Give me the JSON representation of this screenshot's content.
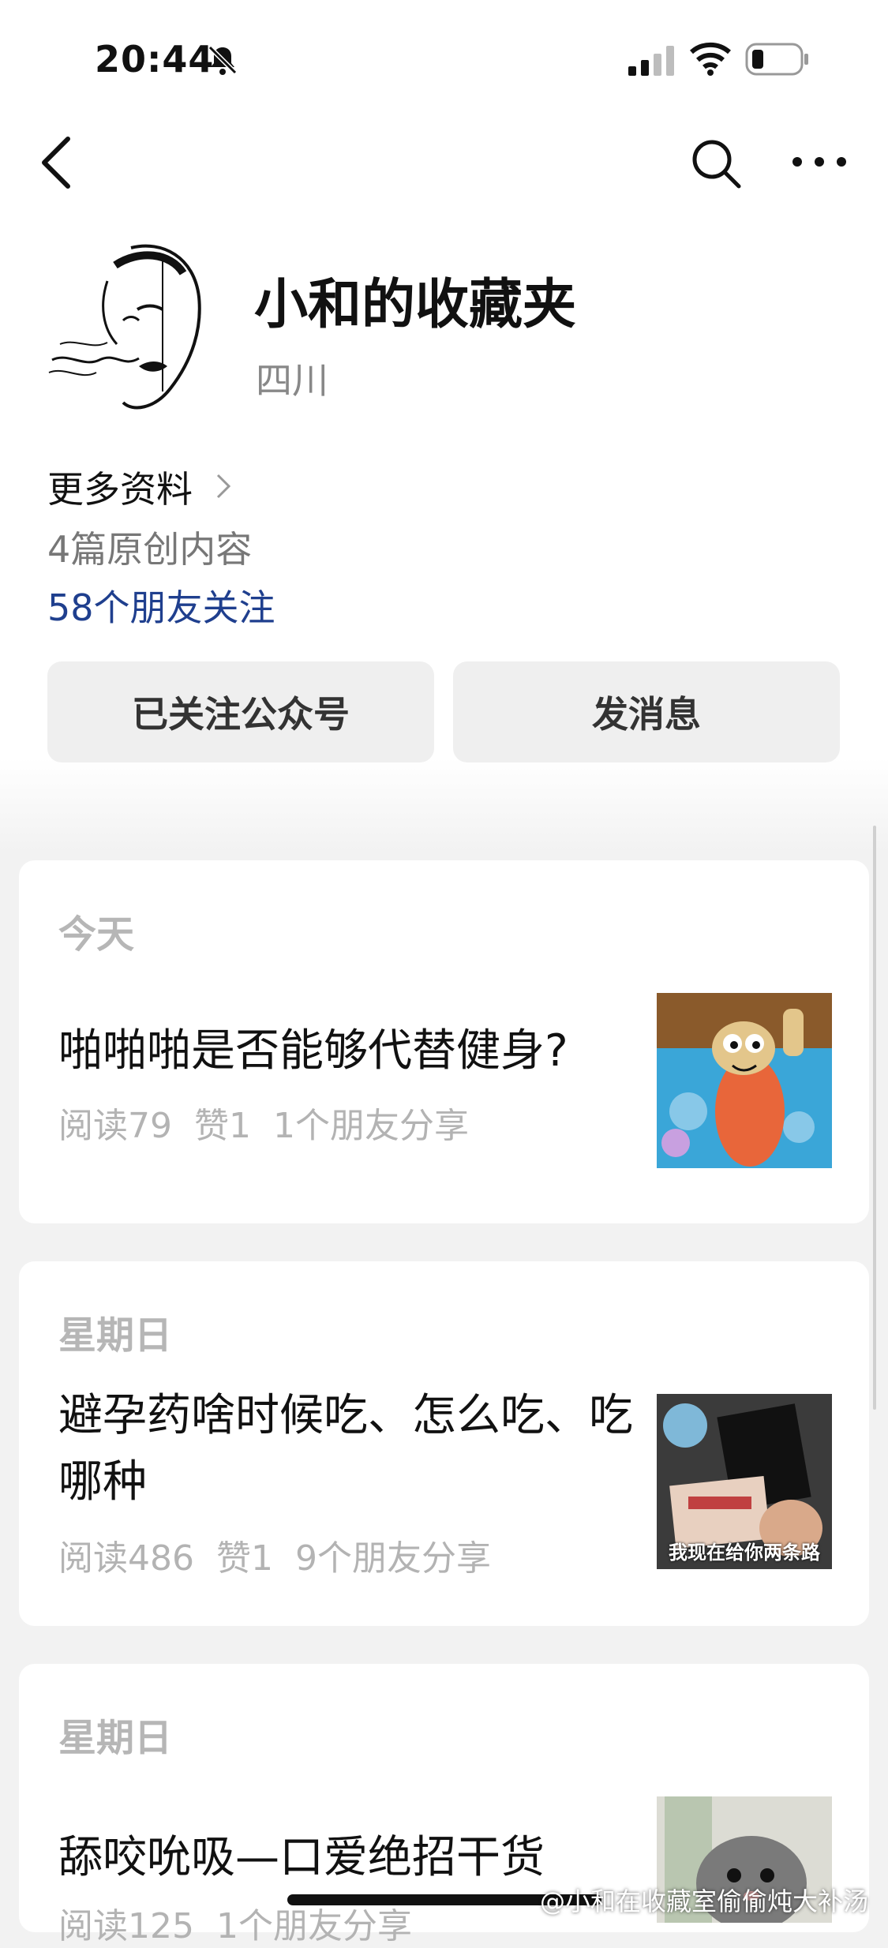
{
  "status_bar": {
    "time": "20:44",
    "icons": [
      "bell-off-icon",
      "signal-icon",
      "wifi-icon",
      "battery-icon"
    ]
  },
  "nav": {
    "icons": [
      "back-chevron-icon",
      "search-icon",
      "more-dots-icon"
    ]
  },
  "profile": {
    "name": "小和的收藏夹",
    "region": "四川",
    "more_info": "更多资料",
    "original_count": "4篇原创内容",
    "friends_follow": "58个朋友关注",
    "friends_follow_color": "#1f3f8e"
  },
  "buttons": {
    "followed": "已关注公众号",
    "message": "发消息"
  },
  "articles": [
    {
      "date": "今天",
      "title": "啪啪啪是否能够代替健身?",
      "reads": "阅读79",
      "likes": "赞1",
      "shares": "1个朋友分享",
      "thumb_icon": "cartoon-fish-thumbnail"
    },
    {
      "date": "星期日",
      "title": "避孕药啥时候吃、怎么吃、吃哪种",
      "reads": "阅读486",
      "likes": "赞1",
      "shares": "9个朋友分享",
      "thumb_icon": "packages-thumbnail",
      "thumb_caption": "我现在给你两条路"
    },
    {
      "date": "星期日",
      "title": "舔咬吮吸—口爱绝招干货",
      "reads": "阅读125",
      "likes": "",
      "shares": "1个朋友分享",
      "thumb_icon": "cat-thumbnail"
    }
  ],
  "watermark": "@小和在收藏室偷偷炖大补汤"
}
